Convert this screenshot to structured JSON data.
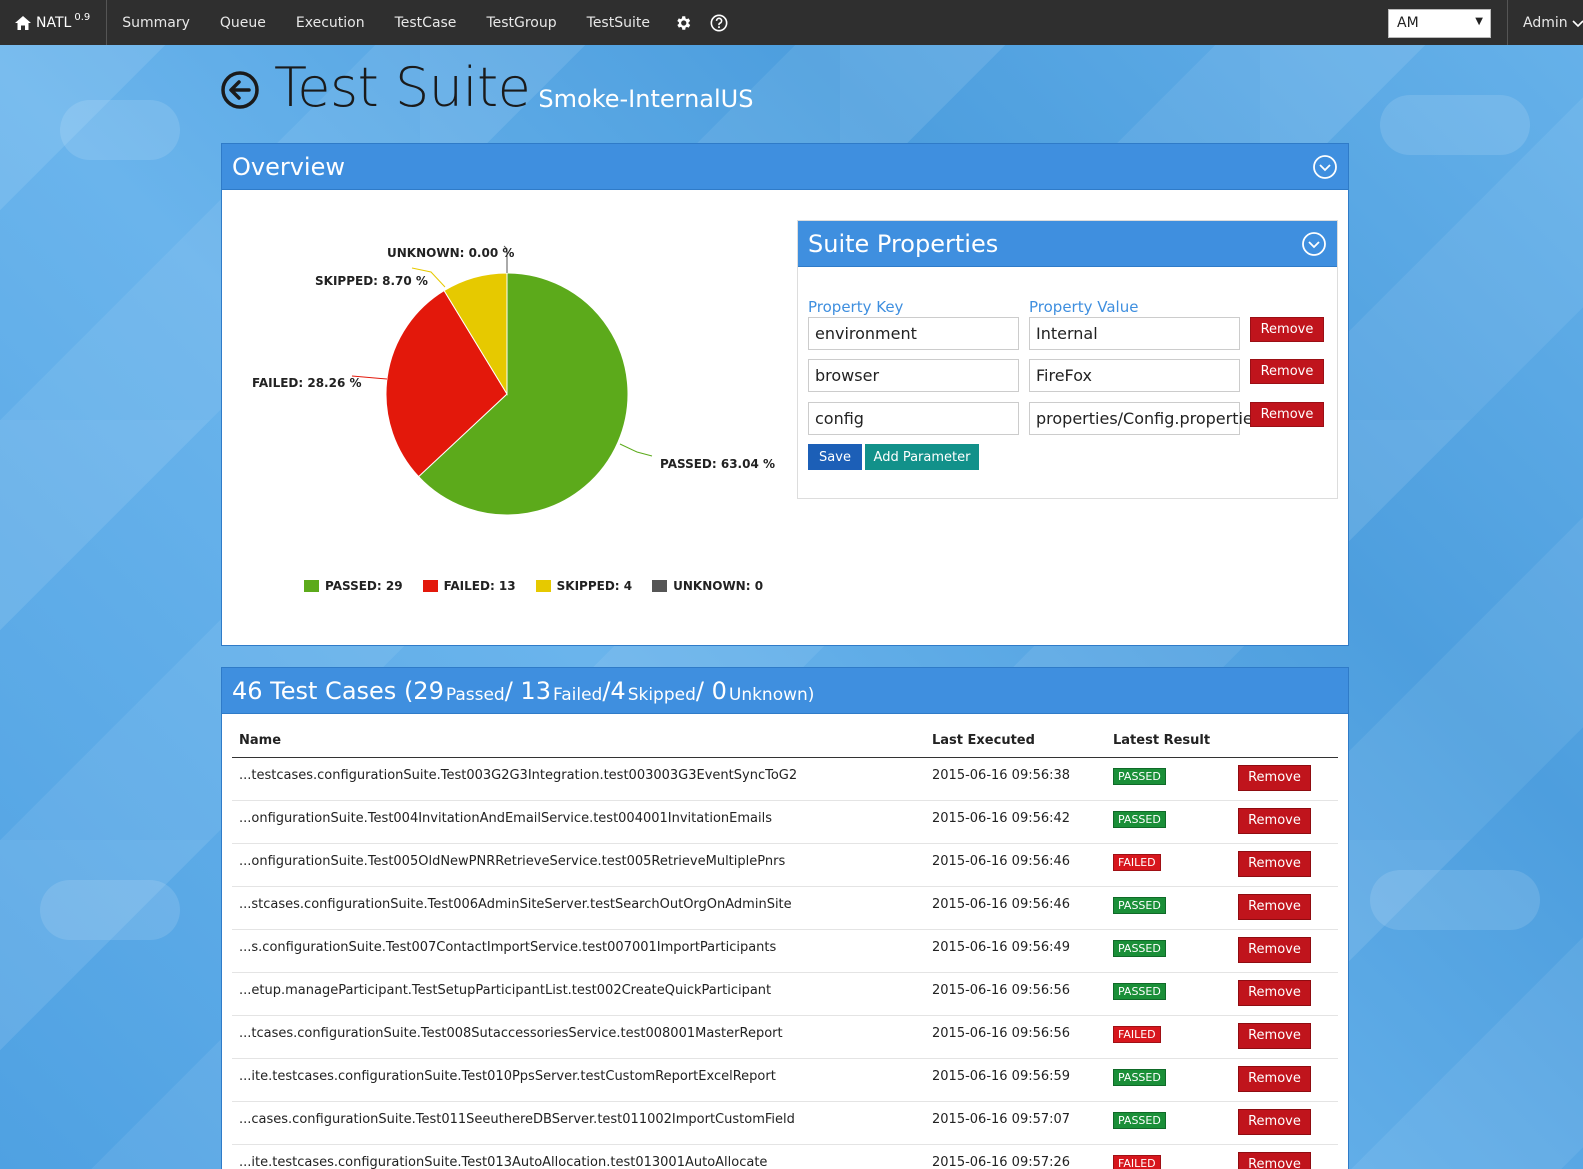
{
  "nav": {
    "brand": "NATL",
    "version": "0.9",
    "items": [
      {
        "label": "Summary"
      },
      {
        "label": "Queue"
      },
      {
        "label": "Execution"
      },
      {
        "label": "TestCase"
      },
      {
        "label": "TestGroup"
      },
      {
        "label": "TestSuite"
      }
    ],
    "project_select": "AM",
    "user": "Admin"
  },
  "page": {
    "title": "Test Suite",
    "subtitle": "Smoke-InternalUS"
  },
  "overview": {
    "title": "Overview",
    "pie_labels": {
      "unknown": "UNKNOWN: 0.00 %",
      "skipped": "SKIPPED: 8.70 %",
      "failed": "FAILED: 28.26 %",
      "passed": "PASSED: 63.04 %"
    },
    "legend": {
      "passed": "PASSED: 29",
      "failed": "FAILED: 13",
      "skipped": "SKIPPED: 4",
      "unknown": "UNKNOWN: 0"
    },
    "colors": {
      "passed": "#5caa1b",
      "failed": "#e3180b",
      "skipped": "#e6c900",
      "unknown": "#555555"
    }
  },
  "chart_data": {
    "type": "pie",
    "categories": [
      "PASSED",
      "FAILED",
      "SKIPPED",
      "UNKNOWN"
    ],
    "values": [
      29,
      13,
      4,
      0
    ],
    "percentages": [
      63.04,
      28.26,
      8.7,
      0.0
    ]
  },
  "suite_properties": {
    "title": "Suite Properties",
    "key_header": "Property Key",
    "value_header": "Property Value",
    "rows": [
      {
        "key": "environment",
        "value": "Internal",
        "remove": "Remove"
      },
      {
        "key": "browser",
        "value": "FireFox",
        "remove": "Remove"
      },
      {
        "key": "config",
        "value": "properties/Config.properties",
        "remove": "Remove"
      }
    ],
    "save_label": "Save",
    "add_label": "Add Parameter"
  },
  "test_cases": {
    "heading_count": "46 Test Cases",
    "heading_parts": [
      {
        "num": "(29",
        "word": "Passed"
      },
      {
        "num": "/ 13",
        "word": "Failed"
      },
      {
        "num": "/4",
        "word": "Skipped"
      },
      {
        "num": "/ 0",
        "word": "Unknown)"
      }
    ],
    "columns": [
      "Name",
      "Last Executed",
      "Latest Result"
    ],
    "rows": [
      {
        "name": "...testcases.configurationSuite.Test003G2G3Integration.test003003G3EventSyncToG2",
        "executed": "2015-06-16 09:56:38",
        "result": "PASSED",
        "action": "Remove"
      },
      {
        "name": "...onfigurationSuite.Test004InvitationAndEmailService.test004001InvitationEmails",
        "executed": "2015-06-16 09:56:42",
        "result": "PASSED",
        "action": "Remove"
      },
      {
        "name": "...onfigurationSuite.Test005OldNewPNRRetrieveService.test005RetrieveMultiplePnrs",
        "executed": "2015-06-16 09:56:46",
        "result": "FAILED",
        "action": "Remove"
      },
      {
        "name": "...stcases.configurationSuite.Test006AdminSiteServer.testSearchOutOrgOnAdminSite",
        "executed": "2015-06-16 09:56:46",
        "result": "PASSED",
        "action": "Remove"
      },
      {
        "name": "...s.configurationSuite.Test007ContactImportService.test007001ImportParticipants",
        "executed": "2015-06-16 09:56:49",
        "result": "PASSED",
        "action": "Remove"
      },
      {
        "name": "...etup.manageParticipant.TestSetupParticipantList.test002CreateQuickParticipant",
        "executed": "2015-06-16 09:56:56",
        "result": "PASSED",
        "action": "Remove"
      },
      {
        "name": "...tcases.configurationSuite.Test008SutaccessoriesService.test008001MasterReport",
        "executed": "2015-06-16 09:56:56",
        "result": "FAILED",
        "action": "Remove"
      },
      {
        "name": "...ite.testcases.configurationSuite.Test010PpsServer.testCustomReportExcelReport",
        "executed": "2015-06-16 09:56:59",
        "result": "PASSED",
        "action": "Remove"
      },
      {
        "name": "...cases.configurationSuite.Test011SeeuthereDBServer.test011002ImportCustomField",
        "executed": "2015-06-16 09:57:07",
        "result": "PASSED",
        "action": "Remove"
      },
      {
        "name": "...ite.testcases.configurationSuite.Test013AutoAllocation.test013001AutoAllocate",
        "executed": "2015-06-16 09:57:26",
        "result": "FAILED",
        "action": "Remove"
      }
    ]
  }
}
